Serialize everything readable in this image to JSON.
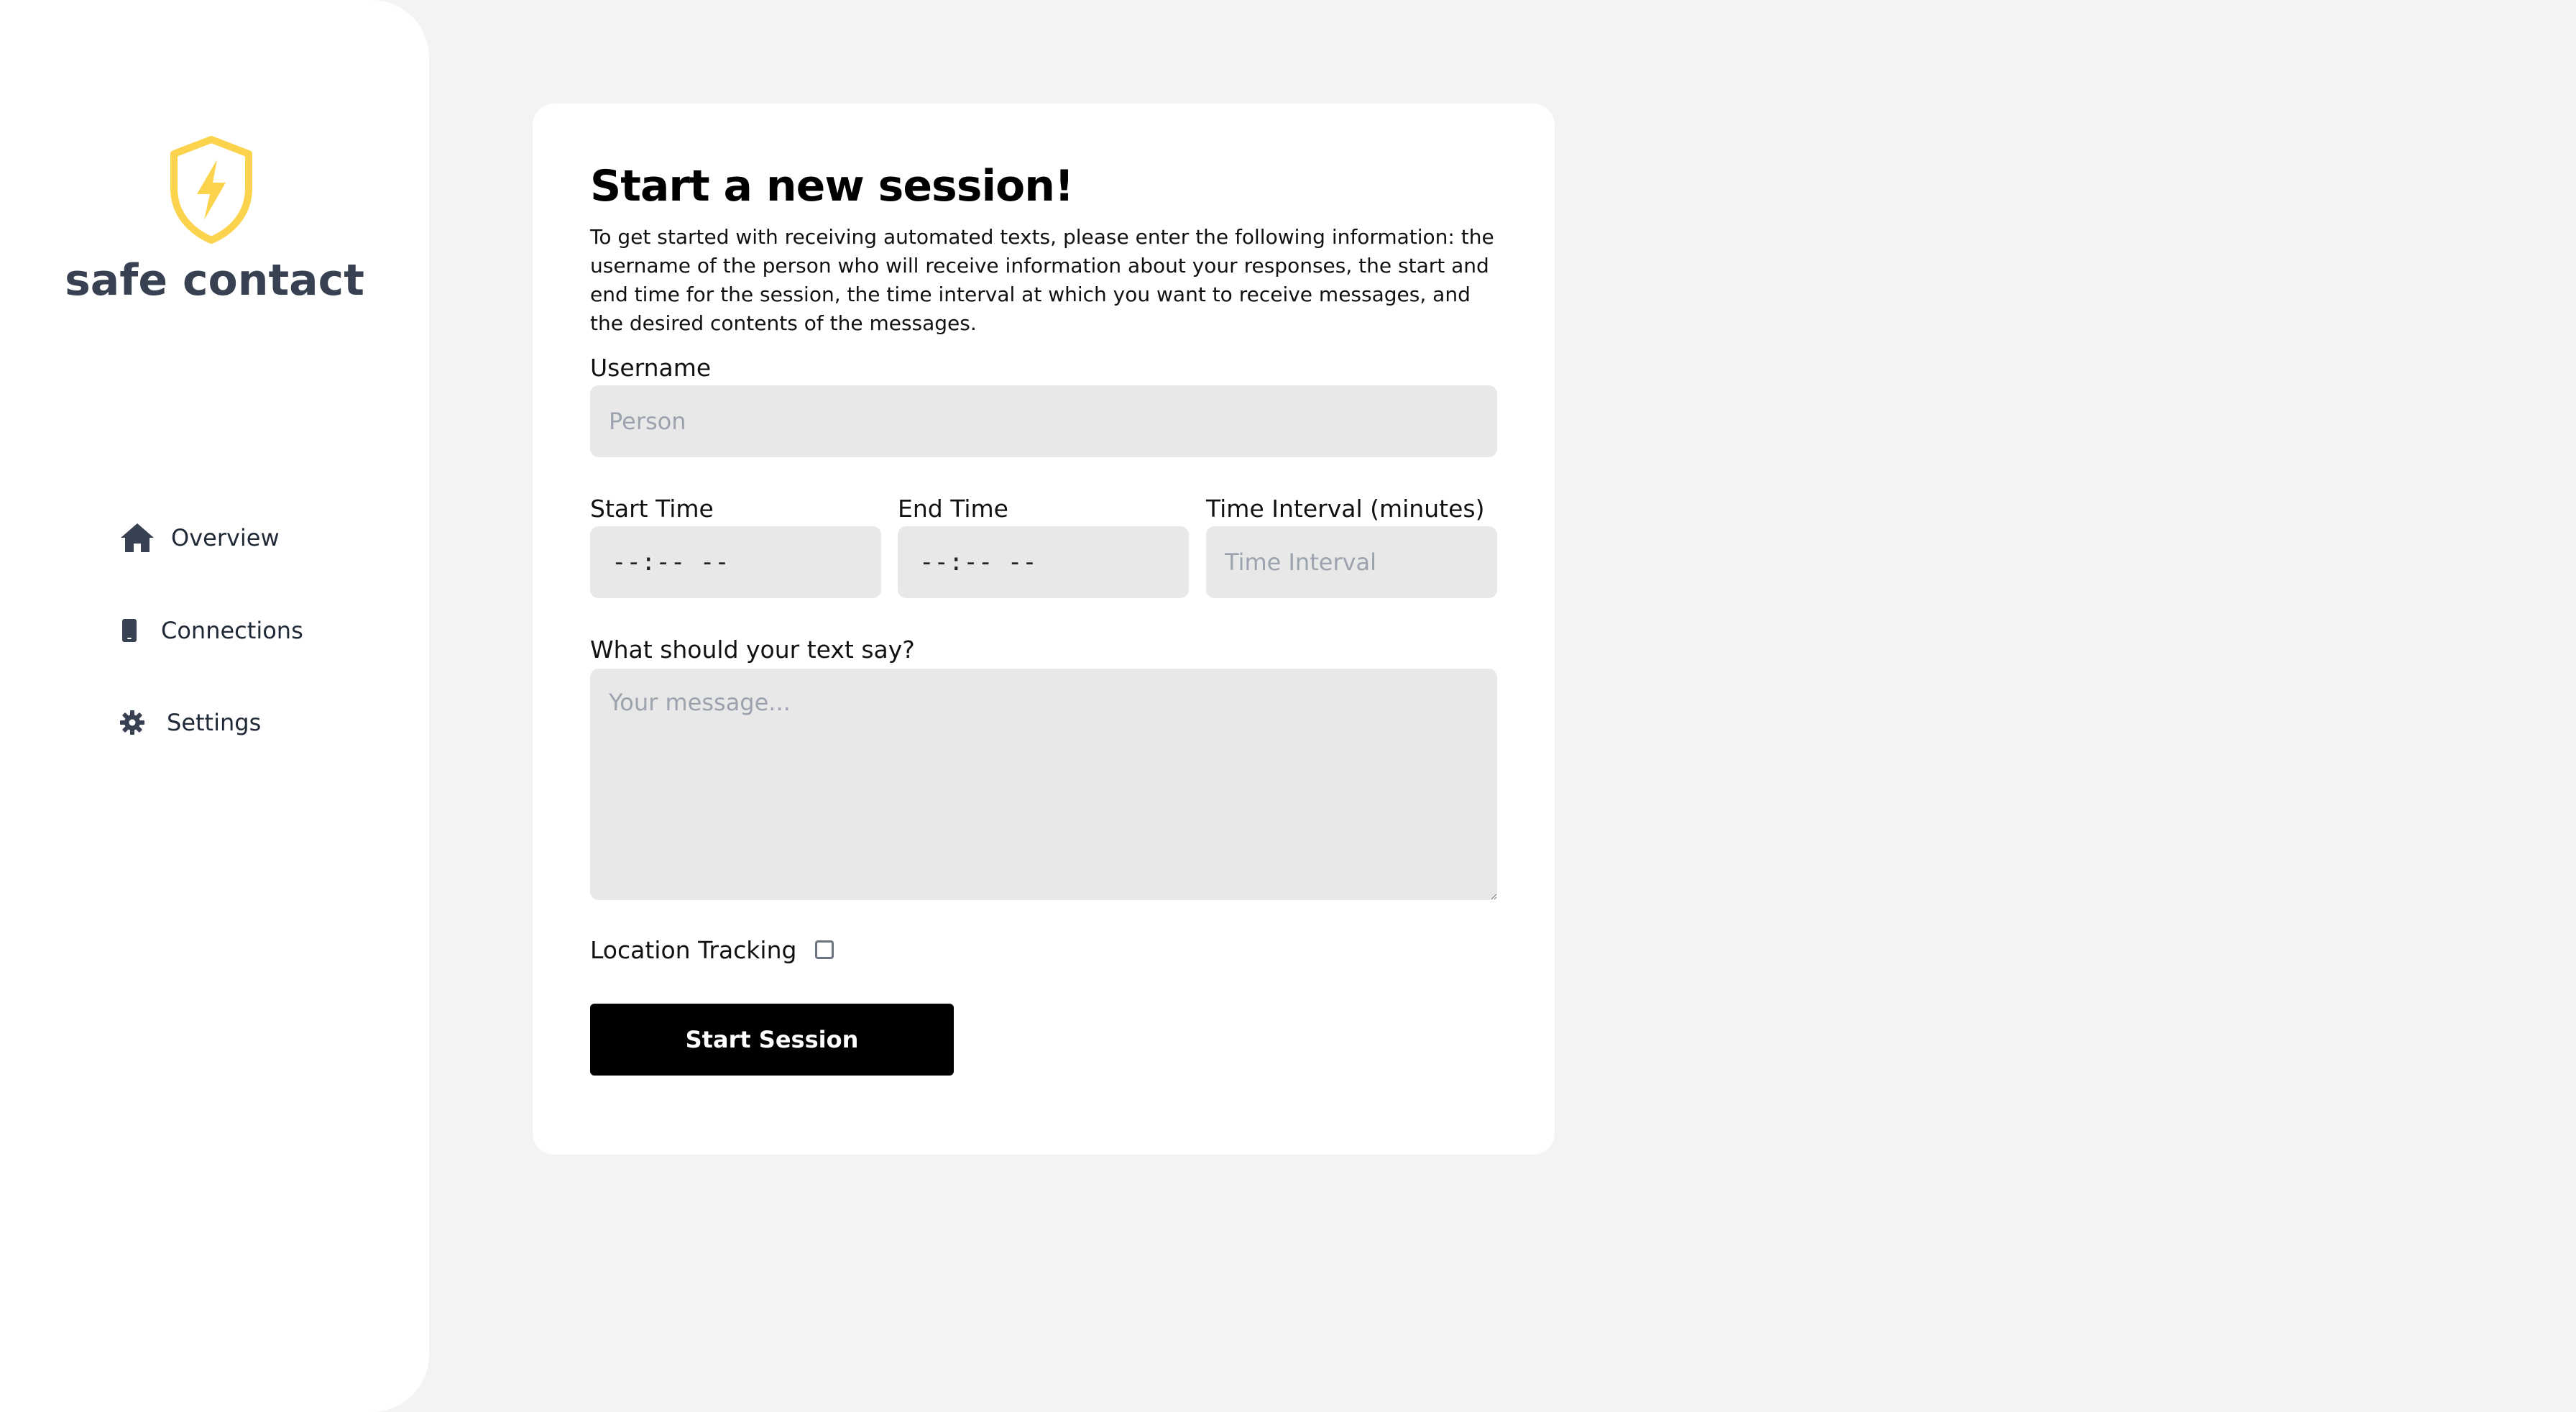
{
  "sidebar": {
    "logo_icon": "shield-bolt-icon",
    "brand": "safe contact",
    "brand_accent": "#fcd34d",
    "items": [
      {
        "label": "Overview",
        "icon": "home-icon"
      },
      {
        "label": "Connections",
        "icon": "phone-icon"
      },
      {
        "label": "Settings",
        "icon": "gear-icon"
      }
    ]
  },
  "form": {
    "title": "Start a new session!",
    "intro": "To get started with receiving automated texts, please enter the following information: the username of the person who will receive information about your responses, the start and end time for the session, the time interval at which you want to receive messages, and the desired contents of the messages.",
    "username_label": "Username",
    "username_placeholder": "Person",
    "start_time_label": "Start Time",
    "start_time_value": "--:-- --",
    "end_time_label": "End Time",
    "end_time_value": "--:-- --",
    "interval_label": "Time Interval (minutes)",
    "interval_placeholder": "Time Interval",
    "message_label": "What should your text say?",
    "message_placeholder": "Your message...",
    "location_label": "Location Tracking",
    "location_checked": false,
    "submit_label": "Start Session"
  },
  "colors": {
    "background": "#f2f3f5",
    "button": "#000000",
    "field": "#e8e8e8"
  }
}
